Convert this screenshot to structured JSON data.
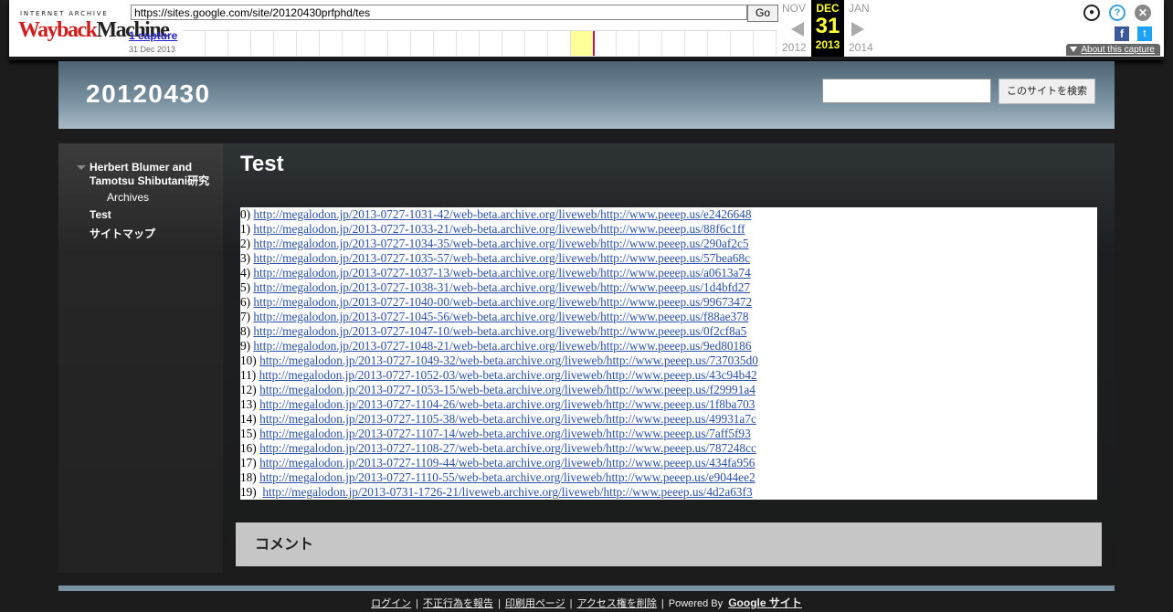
{
  "wayback": {
    "logo_top": "INTERNET ARCHIVE",
    "logo_main_1": "Wayback",
    "logo_main_2": "Machine",
    "url": "https://sites.google.com/site/20120430prfphd/tes",
    "go_label": "Go",
    "captures_label": "1 capture",
    "capture_date": "31 Dec 2013",
    "prev_month": "NOV",
    "cur_month": "DEC",
    "cur_day": "31",
    "cur_year": "2013",
    "next_month": "JAN",
    "prev_year": "2012",
    "next_year": "2014",
    "about_label": "About this capture",
    "icons": [
      "user-icon",
      "help-icon",
      "close-icon",
      "facebook-icon",
      "twitter-icon"
    ]
  },
  "site": {
    "title": "20120430",
    "search_button": "このサイトを検索",
    "search_placeholder": ""
  },
  "sidebar": {
    "items": [
      {
        "label": "Herbert Blumer and Tamotsu Shibutani研究"
      },
      {
        "label": "Archives"
      },
      {
        "label": "Test"
      },
      {
        "label": "サイトマップ"
      }
    ]
  },
  "page": {
    "title": "Test",
    "links": [
      {
        "prefix": "0)",
        "url": "http://megalodon.jp/2013-0727-1031-42/web-beta.archive.org/liveweb/http://www.peeep.us/e2426648"
      },
      {
        "prefix": "1)",
        "url": "http://megalodon.jp/2013-0727-1033-21/web-beta.archive.org/liveweb/http://www.peeep.us/88f6c1ff"
      },
      {
        "prefix": "2)",
        "url": "http://megalodon.jp/2013-0727-1034-35/web-beta.archive.org/liveweb/http://www.peeep.us/290af2c5"
      },
      {
        "prefix": "3)",
        "url": "http://megalodon.jp/2013-0727-1035-57/web-beta.archive.org/liveweb/http://www.peeep.us/57bea68c"
      },
      {
        "prefix": "4)",
        "url": "http://megalodon.jp/2013-0727-1037-13/web-beta.archive.org/liveweb/http://www.peeep.us/a0613a74"
      },
      {
        "prefix": "5)",
        "url": "http://megalodon.jp/2013-0727-1038-31/web-beta.archive.org/liveweb/http://www.peeep.us/1d4bfd27"
      },
      {
        "prefix": "6)",
        "url": "http://megalodon.jp/2013-0727-1040-00/web-beta.archive.org/liveweb/http://www.peeep.us/99673472"
      },
      {
        "prefix": "7)",
        "url": "http://megalodon.jp/2013-0727-1045-56/web-beta.archive.org/liveweb/http://www.peeep.us/f88ae378"
      },
      {
        "prefix": "8)",
        "url": "http://megalodon.jp/2013-0727-1047-10/web-beta.archive.org/liveweb/http://www.peeep.us/0f2cf8a5"
      },
      {
        "prefix": "9)",
        "url": "http://megalodon.jp/2013-0727-1048-21/web-beta.archive.org/liveweb/http://www.peeep.us/9ed80186"
      },
      {
        "prefix": "10)",
        "url": "http://megalodon.jp/2013-0727-1049-32/web-beta.archive.org/liveweb/http://www.peeep.us/737035d0"
      },
      {
        "prefix": "11)",
        "url": "http://megalodon.jp/2013-0727-1052-03/web-beta.archive.org/liveweb/http://www.peeep.us/43c94b42"
      },
      {
        "prefix": "12)",
        "url": "http://megalodon.jp/2013-0727-1053-15/web-beta.archive.org/liveweb/http://www.peeep.us/f29991a4"
      },
      {
        "prefix": "13)",
        "url": "http://megalodon.jp/2013-0727-1104-26/web-beta.archive.org/liveweb/http://www.peeep.us/1f8ba703"
      },
      {
        "prefix": "14)",
        "url": "http://megalodon.jp/2013-0727-1105-38/web-beta.archive.org/liveweb/http://www.peeep.us/49931a7c"
      },
      {
        "prefix": "15)",
        "url": "http://megalodon.jp/2013-0727-1107-14/web-beta.archive.org/liveweb/http://www.peeep.us/7aff5f93"
      },
      {
        "prefix": "16)",
        "url": "http://megalodon.jp/2013-0727-1108-27/web-beta.archive.org/liveweb/http://www.peeep.us/787248cc"
      },
      {
        "prefix": "17)",
        "url": "http://megalodon.jp/2013-0727-1109-44/web-beta.archive.org/liveweb/http://www.peeep.us/434fa956"
      },
      {
        "prefix": "18)",
        "url": "http://megalodon.jp/2013-0727-1110-55/web-beta.archive.org/liveweb/http://www.peeep.us/e9044ee2"
      },
      {
        "prefix": "19)",
        "url": "http://megalodon.jp/2013-0731-1726-21/liveweb.archive.org/liveweb/http://www.peeep.us/4d2a63f3"
      }
    ],
    "comments_title": "コメント"
  },
  "footer": {
    "login": "ログイン",
    "report": "不正行為を報告",
    "print": "印刷用ページ",
    "remove_access": "アクセス権を削除",
    "powered_by": "Powered By",
    "google_sites": "Google サイト"
  },
  "colors": {
    "wayback_accent": "#ffff33",
    "link": "#2a4fa8",
    "header_blue": "#7a92a2"
  }
}
